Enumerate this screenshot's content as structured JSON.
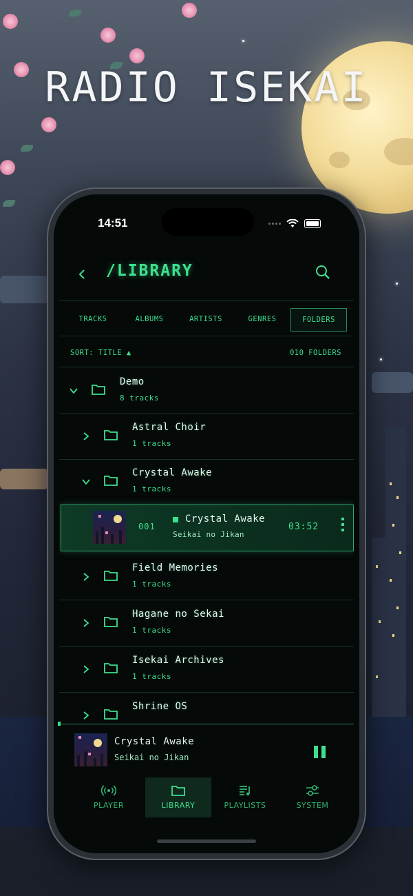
{
  "headline": "RADIO ISEKAI",
  "status": {
    "time": "14:51"
  },
  "header": {
    "title": "/LIBRARY",
    "back_icon": "chevron-left-icon",
    "search_icon": "search-icon"
  },
  "tabs": [
    {
      "label": "TRACKS",
      "active": false
    },
    {
      "label": "ALBUMS",
      "active": false
    },
    {
      "label": "ARTISTS",
      "active": false
    },
    {
      "label": "GENRES",
      "active": false
    },
    {
      "label": "FOLDERS",
      "active": true
    }
  ],
  "sort": {
    "label": "SORT: TITLE ▲",
    "count": "010 FOLDERS"
  },
  "folders": [
    {
      "name": "Demo",
      "sub": "8 tracks",
      "expanded": true
    },
    {
      "name": "Astral Choir",
      "sub": "1 tracks",
      "expanded": false
    },
    {
      "name": "Crystal Awake",
      "sub": "1 tracks",
      "expanded": true
    },
    {
      "name": "Field Memories",
      "sub": "1 tracks",
      "expanded": false
    },
    {
      "name": "Hagane no Sekai",
      "sub": "1 tracks",
      "expanded": false
    },
    {
      "name": "Isekai Archives",
      "sub": "1 tracks",
      "expanded": false
    },
    {
      "name": "Shrine OS",
      "sub": "",
      "expanded": false
    }
  ],
  "track": {
    "number": "001",
    "title": "Crystal Awake",
    "artist": "Seikai no Jikan",
    "duration": "03:52"
  },
  "mini_player": {
    "title": "Crystal Awake",
    "artist": "Seikai no Jikan",
    "state_icon": "pause-icon"
  },
  "nav": [
    {
      "label": "PLAYER",
      "icon": "broadcast-icon",
      "active": false
    },
    {
      "label": "LIBRARY",
      "icon": "folder-icon",
      "active": true
    },
    {
      "label": "PLAYLISTS",
      "icon": "playlist-icon",
      "active": false
    },
    {
      "label": "SYSTEM",
      "icon": "sliders-icon",
      "active": false
    }
  ],
  "colors": {
    "accent": "#3ee08e",
    "background": "#050908",
    "text": "#e4f7ec"
  }
}
